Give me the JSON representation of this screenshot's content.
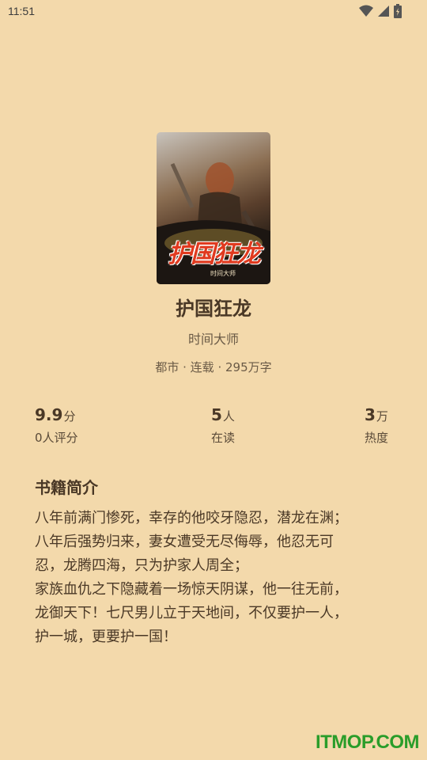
{
  "status_bar": {
    "time": "11:51",
    "icons": [
      "wifi-icon",
      "signal-icon",
      "battery-icon"
    ]
  },
  "book": {
    "cover_title": "护国狂龙",
    "cover_author": "时间大师",
    "title": "护国狂龙",
    "author": "时间大师",
    "meta": "都市 · 连载 · 295万字"
  },
  "stats": [
    {
      "value": "9.9",
      "unit": "分",
      "label": "0人评分"
    },
    {
      "value": "5",
      "unit": "人",
      "label": "在读"
    },
    {
      "value": "3",
      "unit": "万",
      "label": "热度"
    }
  ],
  "intro": {
    "heading": "书籍简介",
    "text": "八年前满门惨死，幸存的他咬牙隐忍，潜龙在渊；\n八年后强势归来，妻女遭受无尽侮辱，他忍无可\n忍，龙腾四海，只为护家人周全；\n家族血仇之下隐藏着一场惊天阴谋，他一往无前，\n龙御天下！七尺男儿立于天地间，不仅要护一人，\n护一城，更要护一国！"
  },
  "watermark": "ITMOP.COM",
  "colors": {
    "background": "#f3d9ab",
    "text": "#4a3826",
    "watermark": "#2a9d2a"
  }
}
